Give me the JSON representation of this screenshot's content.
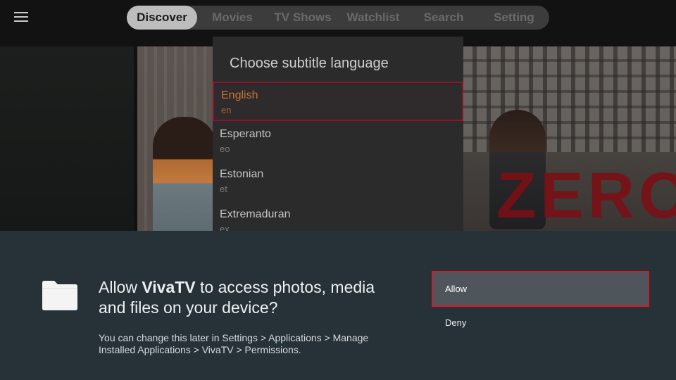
{
  "nav": {
    "menu_icon": "hamburger-menu-icon",
    "tabs": [
      {
        "label": "Discover",
        "active": true
      },
      {
        "label": "Movies",
        "active": false
      },
      {
        "label": "TV Shows",
        "active": false
      },
      {
        "label": "Watchlist",
        "active": false
      },
      {
        "label": "Search",
        "active": false
      },
      {
        "label": "Setting",
        "active": false
      }
    ]
  },
  "hero": {
    "title_text": "ZERO"
  },
  "subtitle_dialog": {
    "title": "Choose subtitle language",
    "items": [
      {
        "name": "English",
        "code": "en",
        "selected": true
      },
      {
        "name": "Esperanto",
        "code": "eo",
        "selected": false
      },
      {
        "name": "Estonian",
        "code": "et",
        "selected": false
      },
      {
        "name": "Extremaduran",
        "code": "ex",
        "selected": false
      }
    ]
  },
  "permission": {
    "icon": "folder-icon",
    "message_pre": "Allow ",
    "app_name": "VivaTV",
    "message_post": " to access photos, media and files on your device?",
    "note": "You can change this later in Settings > Applications > Manage Installed Applications > VivaTV > Permissions.",
    "allow_label": "Allow",
    "deny_label": "Deny"
  },
  "colors": {
    "accent_red": "#d71a2a",
    "selected_border": "#8b1530",
    "selected_text": "#c9733b",
    "sheet_bg": "#263238"
  }
}
